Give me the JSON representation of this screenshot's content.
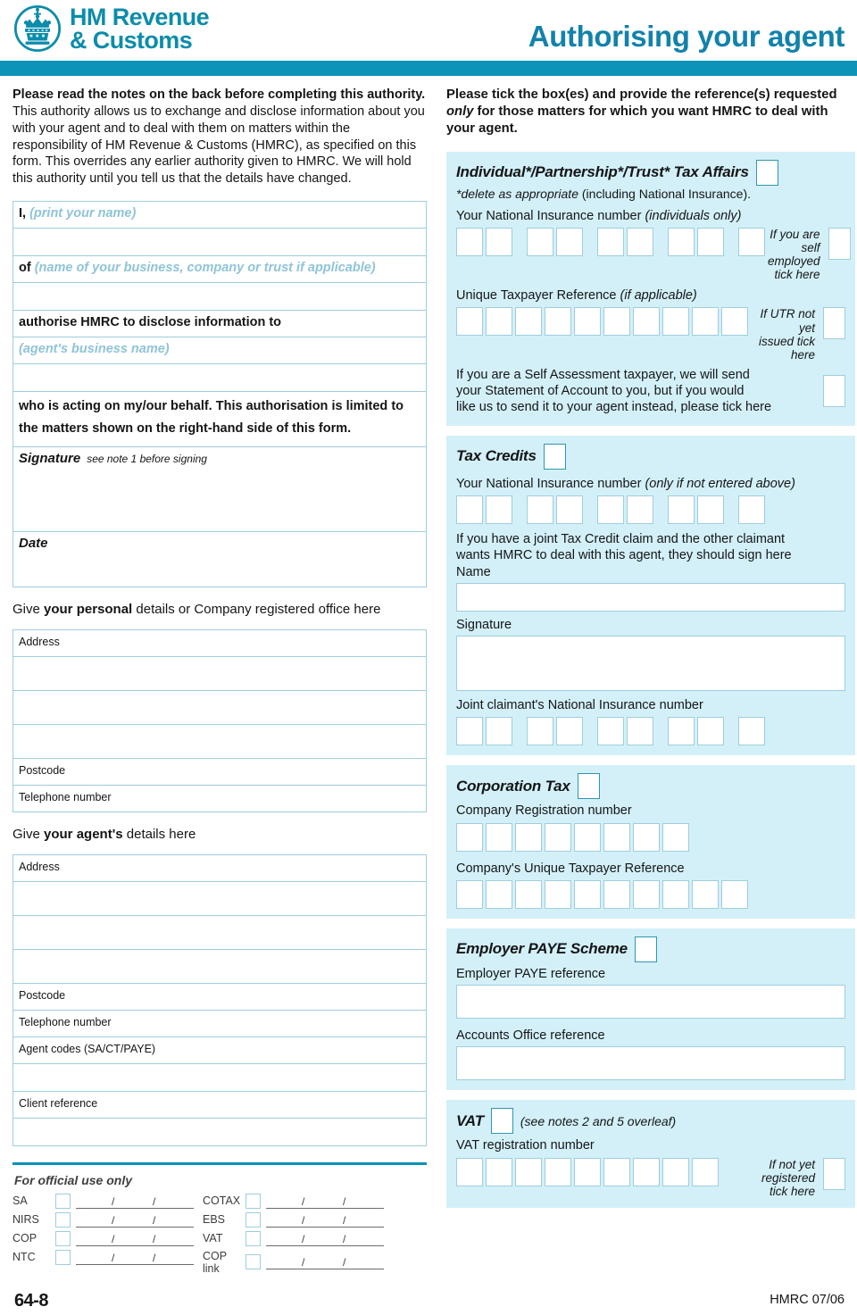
{
  "header": {
    "logo_line1": "HM Revenue",
    "logo_line2": "& Customs",
    "logo_icon": "royal-crown-icon",
    "title": "Authorising your agent",
    "brand_color": "#0C93B7"
  },
  "left": {
    "intro_bold": "Please read the notes on the back before completing this authority.",
    "intro_rest": " This authority allows us to exchange and disclose information about you with your agent and to deal with them on matters within the responsibility of HM Revenue & Customs (HMRC), as specified on this form. This overrides any earlier authority given to HMRC. We will hold this authority until you tell us that the details have changed.",
    "i_label": "I,",
    "i_hint": "(print your name)",
    "of_label": "of",
    "of_hint": "(name of your business, company or trust if applicable)",
    "authorise_label": "authorise HMRC to disclose information to",
    "agent_hint": "(agent's business name)",
    "behalf_line1": "who is acting on my/our behalf. This authorisation is limited to",
    "behalf_line2": "the matters shown on the right-hand side of this form.",
    "signature_label": "Signature",
    "signature_note": "see note 1 before signing",
    "date_label": "Date",
    "personal_head_pre": "Give ",
    "personal_head_bold": "your personal",
    "personal_head_post": " details or Company registered office here",
    "address_label": "Address",
    "postcode_label": "Postcode",
    "telephone_label": "Telephone number",
    "agent_head_pre": "Give ",
    "agent_head_bold": "your agent's",
    "agent_head_post": " details here",
    "agent_codes_label": "Agent codes (SA/CT/PAYE)",
    "client_reference_label": "Client reference"
  },
  "official": {
    "title": "For official use only",
    "col1": [
      {
        "name": "SA"
      },
      {
        "name": "NIRS"
      },
      {
        "name": "COP"
      },
      {
        "name": "NTC"
      }
    ],
    "col2": [
      {
        "name": "COTAX"
      },
      {
        "name": "EBS"
      },
      {
        "name": "VAT"
      },
      {
        "name": "COP link"
      }
    ],
    "slash": "/",
    "form_number": "64-8"
  },
  "right": {
    "intro_part1": "Please tick the box(es) and provide the reference(s) requested ",
    "intro_italic": "only",
    "intro_part2": " for those matters for which you want HMRC to deal with your agent.",
    "individual": {
      "title": "Individual*/Partnership*/Trust* Tax Affairs",
      "subtitle_italic": "*delete as appropriate",
      "subtitle_rest": " (including National Insurance).",
      "ni_label": "Your National Insurance number",
      "ni_label_italic": "(individuals only)",
      "ni_boxes": 9,
      "self_employed_note_l1": "If you are",
      "self_employed_note_l2": "self employed",
      "self_employed_note_l3": "tick here",
      "utr_label": "Unique Taxpayer Reference",
      "utr_label_italic": "(if applicable)",
      "utr_boxes": 10,
      "utr_note_l1": "If UTR not yet",
      "utr_note_l2": "issued tick here",
      "soa_l1": "If you are a Self Assessment taxpayer, we will send",
      "soa_l2": "your Statement of Account to you, but if you would",
      "soa_l3": "like us to send it to your agent instead, please tick here"
    },
    "tax_credits": {
      "title": "Tax Credits",
      "ni_label": "Your National Insurance number",
      "ni_label_italic": "(only if not entered above)",
      "ni_boxes": 9,
      "joint_l1": "If you have a joint Tax Credit claim and the other claimant",
      "joint_l2": "wants HMRC to deal with this agent, they should sign here",
      "name_label": "Name",
      "signature_label": "Signature",
      "joint_ni_label": "Joint claimant's National Insurance number",
      "joint_ni_boxes": 9
    },
    "corporation_tax": {
      "title": "Corporation Tax",
      "crn_label": "Company Registration number",
      "crn_boxes": 8,
      "cutr_label": "Company's Unique Taxpayer Reference",
      "cutr_boxes": 10
    },
    "employer_paye": {
      "title": "Employer PAYE Scheme",
      "paye_ref_label": "Employer PAYE reference",
      "accounts_office_label": "Accounts Office reference"
    },
    "vat": {
      "title": "VAT",
      "note": "(see notes 2 and 5 overleaf)",
      "reg_label": "VAT registration number",
      "reg_boxes": 9,
      "not_registered_l1": "If not yet",
      "not_registered_l2": "registered",
      "not_registered_l3": "tick here"
    }
  },
  "footer": {
    "code": "HMRC 07/06"
  }
}
